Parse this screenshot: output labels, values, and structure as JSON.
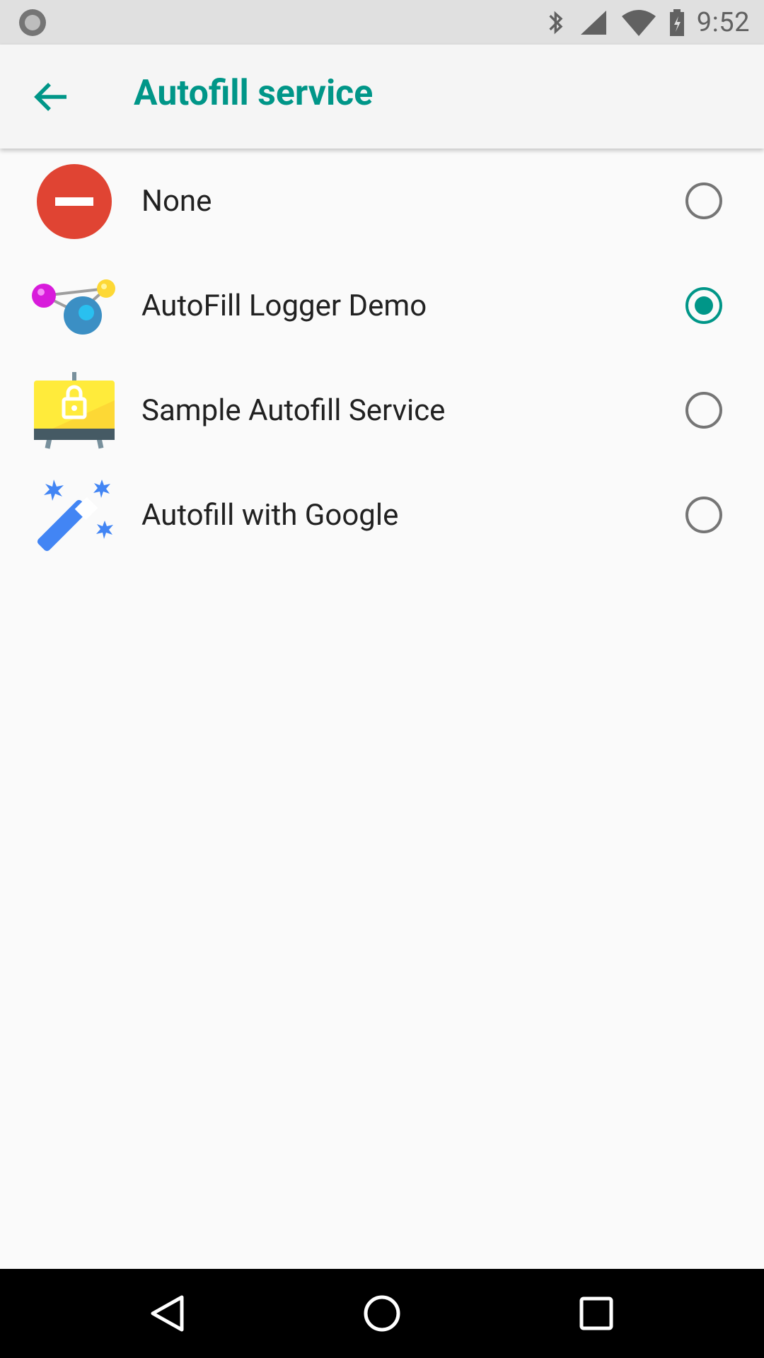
{
  "status_bar": {
    "time": "9:52",
    "icons": [
      "notification-dot-icon",
      "bluetooth-icon",
      "cell-signal-icon",
      "wifi-icon",
      "battery-icon"
    ]
  },
  "app_bar": {
    "title": "Autofill service",
    "back_icon": "arrow-left-icon",
    "accent_color": "#009688"
  },
  "options": [
    {
      "label": "None",
      "icon": "none-icon",
      "selected": false
    },
    {
      "label": "AutoFill Logger Demo",
      "icon": "logger-demo-icon",
      "selected": true
    },
    {
      "label": "Sample Autofill Service",
      "icon": "sample-autofill-icon",
      "selected": false
    },
    {
      "label": "Autofill with Google",
      "icon": "google-autofill-icon",
      "selected": false
    }
  ],
  "nav_bar": {
    "icons": [
      "back-triangle-icon",
      "home-circle-icon",
      "recents-square-icon"
    ]
  }
}
